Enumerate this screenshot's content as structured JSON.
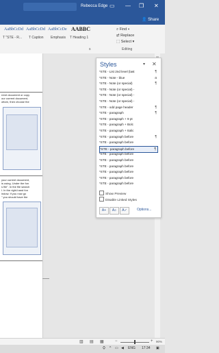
{
  "titlebar": {
    "user": "Rebecca Edge",
    "minimize": "—",
    "restore": "❐",
    "close": "✕",
    "account_icon": "person-icon"
  },
  "ribbonbar": {
    "share": "Share"
  },
  "ribbon": {
    "style_previews": [
      "AaBbCcDd",
      "AaBbCcDd",
      "AaBbCcDe",
      "AABBC"
    ],
    "style_names": [
      "T \"STE - R...",
      "T Caption",
      "Emphasis",
      "T Heading 1"
    ],
    "editing": {
      "find": "Find",
      "replace": "Replace",
      "select": "Select",
      "group_label": "Editing"
    },
    "styles_group_label": "s"
  },
  "document": {
    "lines_top": [
      "rrent document or copy",
      "our current document,",
      "ottom, then choose the"
    ],
    "lines_mid": [
      "your current document,",
      "is using. Under the fon",
      "s file\". In the file search",
      "l. In the right-hand fon",
      "indow. If you now go",
      "\" you should have the"
    ]
  },
  "styles_pane": {
    "title": "Styles",
    "rows": [
      {
        "label": "*STE - List 2nd level (last",
        "mark": "¶",
        "selected": false
      },
      {
        "label": "*STE - Note - blue",
        "mark": "a",
        "selected": false
      },
      {
        "label": "*STE - Note (or special)",
        "mark": "¶",
        "selected": false
      },
      {
        "label": "*STE - Note (or special) -",
        "mark": "",
        "selected": false
      },
      {
        "label": "*STE - Note (or special) -",
        "mark": "",
        "selected": false
      },
      {
        "label": "*STE - Note (or special) -",
        "mark": "",
        "selected": false
      },
      {
        "label": "*STE - odd page header",
        "mark": "¶",
        "selected": false
      },
      {
        "label": "*STE - paragraph",
        "mark": "¶",
        "selected": false
      },
      {
        "label": "*STE - paragraph + 9 pt",
        "mark": "",
        "selected": false
      },
      {
        "label": "*STE - paragraph + Bolc",
        "mark": "",
        "selected": false
      },
      {
        "label": "*STE - paragraph + Italic",
        "mark": "",
        "selected": false
      },
      {
        "label": "*STE - paragraph before",
        "mark": "¶",
        "selected": false
      },
      {
        "label": "*STE - paragraph before",
        "mark": "",
        "selected": false
      },
      {
        "label": "*STE - paragraph before",
        "mark": "¶",
        "selected": true
      },
      {
        "label": "*STE - paragraph before",
        "mark": "",
        "selected": false
      },
      {
        "label": "*STE - paragraph before",
        "mark": "",
        "selected": false
      },
      {
        "label": "*STE - paragraph before",
        "mark": "",
        "selected": false
      },
      {
        "label": "*STE - paragraph before",
        "mark": "",
        "selected": false
      },
      {
        "label": "*STE - paragraph before",
        "mark": "",
        "selected": false
      },
      {
        "label": "*STE - paragraph before",
        "mark": "",
        "selected": false
      }
    ],
    "show_preview": "Show Preview",
    "disable_linked": "Disable Linked Styles",
    "options": "Options..."
  },
  "statusbar": {
    "zoom_minus": "−",
    "zoom_plus": "+",
    "zoom": "90%"
  },
  "taskbar": {
    "lang": "ENG",
    "time": "17:34"
  }
}
